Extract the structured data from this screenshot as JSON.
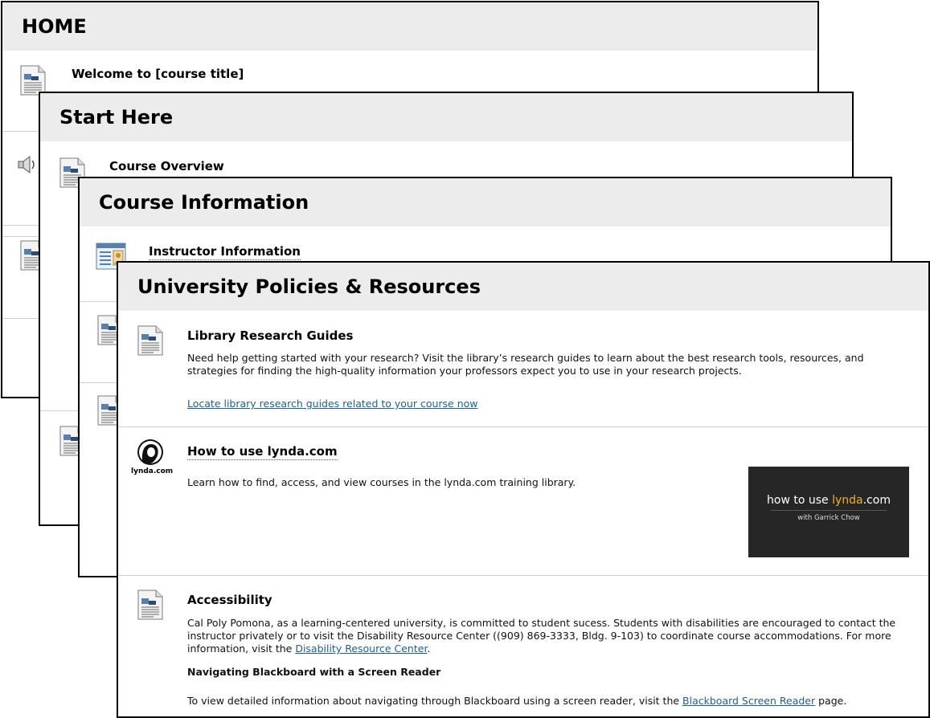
{
  "panels": {
    "home": {
      "title": "HOME",
      "item_title": "Welcome to [course title]"
    },
    "start_here": {
      "title": "Start Here",
      "item_title": "Course Overview"
    },
    "course_information": {
      "title": "Course Information",
      "item_title": "Instructor Information"
    },
    "university_policies": {
      "title": "University Policies & Resources",
      "library": {
        "title": "Library Research Guides",
        "description": "Need help getting started with your research? Visit the library’s research guides to learn about the best research tools, resources, and strategies for finding the high-quality information your professors expect you to use in your research projects.",
        "link": "Locate library research guides related to your course now"
      },
      "lynda": {
        "logo_text": "lynda.com",
        "title": "How to use lynda.com",
        "description": "Learn how to find, access, and view courses in the lynda.com training library.",
        "video_prefix": "how to use ",
        "video_brand": "lynda",
        "video_suffix": ".com",
        "video_author": "with Garrick Chow"
      },
      "accessibility": {
        "title": "Accessibility",
        "text_before_link": "Cal Poly Pomona, as a learning-centered university, is committed to student sucess. Students with disabilities are encouraged to contact the instructor privately or to visit the Disability Resource Center ((909) 869-3333, Bldg. 9-103) to coordinate course accommodations. For more information, visit the ",
        "drc_link": "Disability Resource Center",
        "text_after_link": ".",
        "screen_reader_heading": "Navigating Blackboard with a Screen Reader",
        "screen_reader_before": "To view detailed information about navigating through Blackboard using a screen reader, visit the ",
        "screen_reader_link": "Blackboard Screen Reader",
        "screen_reader_after": " page."
      }
    }
  },
  "colors": {
    "header_bg": "#ececec",
    "link": "#1f5f8b",
    "border": "#000000",
    "divider": "#cfcfcf"
  }
}
